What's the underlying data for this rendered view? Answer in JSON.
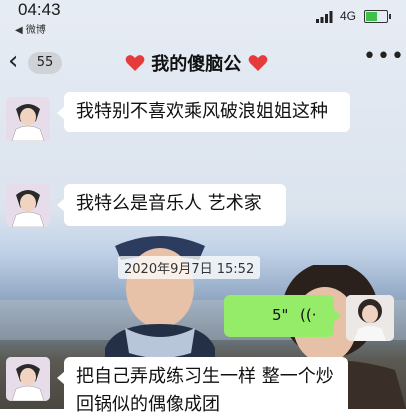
{
  "status_bar": {
    "time": "04:43",
    "back_app": "◀ 微博",
    "network": "4G",
    "battery_level": 0.55
  },
  "header": {
    "unread_count": "55",
    "title": "我的傻脑公",
    "title_icon": "heart-emoji",
    "more_label": "•••"
  },
  "messages": [
    {
      "sender": "other",
      "text": "我特别不喜欢乘风破浪姐姐这种"
    },
    {
      "sender": "other",
      "text": "我特么是音乐人 艺术家"
    },
    {
      "sender": "self",
      "type": "voice",
      "duration": "5\"",
      "wave": "((·"
    },
    {
      "sender": "other",
      "text": "把自己弄成练习生一样 整一个炒回锅似的偶像成团"
    }
  ],
  "timestamp": "2020年9月7日 15:52",
  "colors": {
    "voice_bubble": "#95ec69",
    "bubble": "#ffffff",
    "heart": "#e53b3b"
  }
}
